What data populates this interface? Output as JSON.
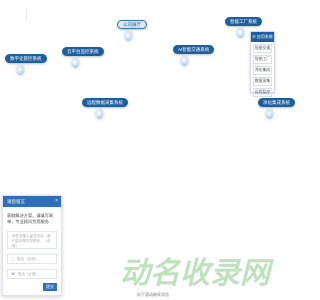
{
  "map": {
    "labels": [
      {
        "text": "公司展厅",
        "variant": "light"
      },
      {
        "text": "智能工厂系统",
        "variant": "dark"
      },
      {
        "text": "AI智能交通系统",
        "variant": "dark"
      },
      {
        "text": "云平台监控系统",
        "variant": "dark"
      },
      {
        "text": "数字化管控系统",
        "variant": "dark"
      },
      {
        "text": "远程数据采集系统",
        "variant": "dark"
      },
      {
        "text": "净化集成系统",
        "variant": "dark"
      }
    ]
  },
  "side_menu": {
    "header": "☰ 应用系统",
    "items": [
      "智能交通",
      "智能工厂",
      "净化集成",
      "数据采集",
      "远程监控"
    ]
  },
  "form": {
    "header": "请您留言",
    "close_icon": "×",
    "title": "获取解决方案，请填写表单，专业顾问为您服务",
    "message_placeholder": "请在此输入留言内容，我们会尽快与您联系。（必填）",
    "name_placeholder": "姓名（必填）",
    "phone_placeholder": "电话（必填）",
    "submit_label": "提交"
  },
  "watermark_text": "动名收录网",
  "bottom_link": "向下滚动继续浏览",
  "colors": {
    "primary": "#1d5f9e",
    "form_header": "#2f6fb7",
    "watermark": "#a9d7a9"
  }
}
